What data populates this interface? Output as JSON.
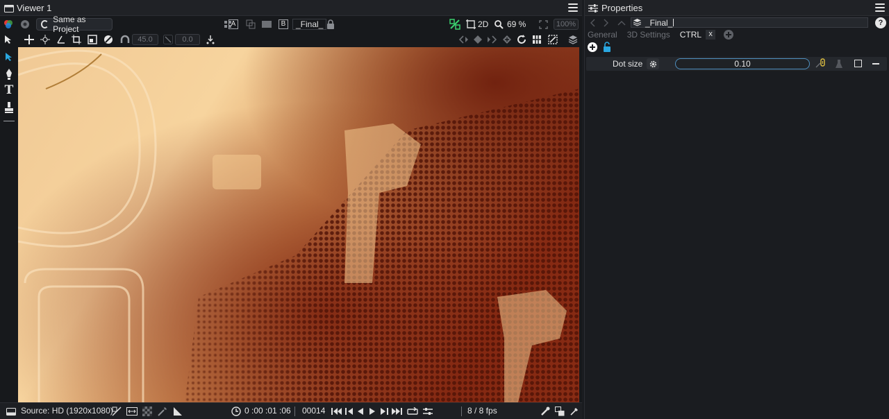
{
  "viewer": {
    "title": "Viewer 1",
    "color_space": "Same as Project",
    "slot_a": "A",
    "slot_b": "B",
    "node_name": "_Final_",
    "view_mode": "2D",
    "zoom": "69 %",
    "zoom_full": "100%",
    "angle_value": "45.0",
    "offset_value": "0.0"
  },
  "status": {
    "source": "Source: HD (1920x1080)",
    "timecode": "0 :00 :01 :06",
    "frame": "00014",
    "fps": "8 / 8 fps"
  },
  "properties": {
    "title": "Properties",
    "node_name": "_Final_",
    "tabs": [
      "General",
      "3D Settings",
      "CTRL"
    ],
    "close_tab": "x",
    "param_label": "Dot size",
    "param_value": "0.10",
    "help": "?"
  },
  "colors": {
    "accent": "#4f8fbf",
    "link_green": "#3bd16f",
    "warning": "#e0c040",
    "lock_blue": "#2aa7e0"
  }
}
